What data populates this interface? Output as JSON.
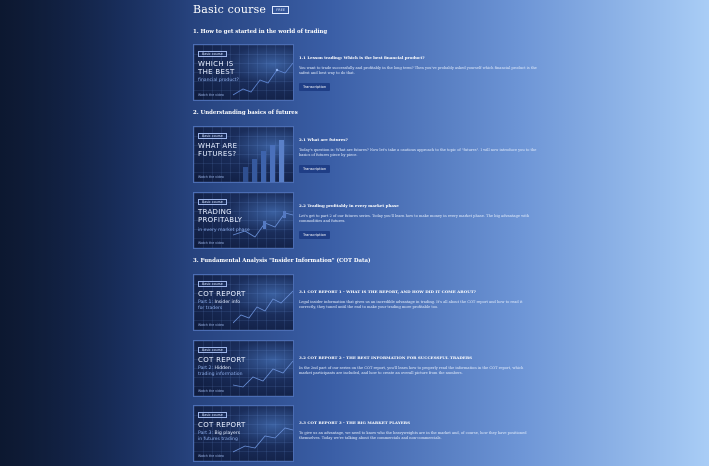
{
  "page": {
    "title": "Basic course",
    "badge": "FREE"
  },
  "sections": [
    {
      "title": "1. How to get started in the world of trading"
    },
    {
      "title": "2. Understanding basics of futures"
    },
    {
      "title": "3. Fundamental Analysis \"Insider Information\" (COT Data)"
    }
  ],
  "lessons": [
    {
      "tag": "Basic course",
      "thumb_title": "WHICH IS THE BEST",
      "thumb_subtitle": "financial product?",
      "thumb_footer": "Watch the video",
      "title": "1.1 Lesson trading: Which is the best financial product?",
      "description": "You want to trade successfully and profitably in the long term? Then you've probably asked yourself which financial product is the safest and best way to do that.",
      "button": "Transcription"
    },
    {
      "tag": "Basic course",
      "thumb_title": "WHAT ARE FUTURES?",
      "thumb_subtitle": "",
      "thumb_footer": "Watch the video",
      "title": "2.1 What are futures?",
      "description": "Today's question is: What are futures? Now let's take a cautious approach to the topic of \"futures\". I will now introduce you to the basics of futures piece by piece.",
      "button": "Transcription"
    },
    {
      "tag": "Basic course",
      "thumb_title": "TRADING PROFITABLY",
      "thumb_subtitle": "in every market phase",
      "thumb_footer": "Watch the video",
      "title": "2.2 Trading profitably in every market phase",
      "description": "Let's get to part 2 of our futures series. Today you'll learn how to make money in every market phase. The big advantage with commodities and futures.",
      "button": "Transcription"
    },
    {
      "tag": "Basic course",
      "thumb_title": "COT REPORT",
      "thumb_subtitle_prefix": "Part 1:",
      "thumb_subtitle_bold": "Insider info",
      "thumb_subtitle": "for traders",
      "thumb_footer": "Watch the video",
      "title": "3.1 COT REPORT 1 - WHAT IS THE REPORT, AND HOW DID IT COME ABOUT?",
      "description": "Legal insider information that gives us an incredible advantage in trading. It's all about the COT report and how to read it correctly, they tuned until the end to make your trading more profitable too.",
      "button": ""
    },
    {
      "tag": "Basic course",
      "thumb_title": "COT REPORT",
      "thumb_subtitle_prefix": "Part 2:",
      "thumb_subtitle_bold": "Hidden",
      "thumb_subtitle": "trading information",
      "thumb_footer": "Watch the video",
      "title": "3.2 COT REPORT 2 - THE BEST INFORMATION FOR SUCCESSFUL TRADERS",
      "description": "In the 2nd part of our series on the COT report, you'll learn how to properly read the information in the COT report, which market participants are included, and how to create an overall picture from the numbers.",
      "button": ""
    },
    {
      "tag": "Basic course",
      "thumb_title": "COT REPORT",
      "thumb_subtitle_prefix": "Part 3:",
      "thumb_subtitle_bold": "Big players",
      "thumb_subtitle": "in futures trading",
      "thumb_footer": "Watch the video",
      "title": "3.3 COT REPORT 3 - THE BIG MARKET PLAYERS",
      "description": "To give us an advantage, we need to know who the heavyweights are in the market and, of course, how they have positioned themselves. Today we're talking about the commercials and non-commercials.",
      "button": ""
    }
  ]
}
